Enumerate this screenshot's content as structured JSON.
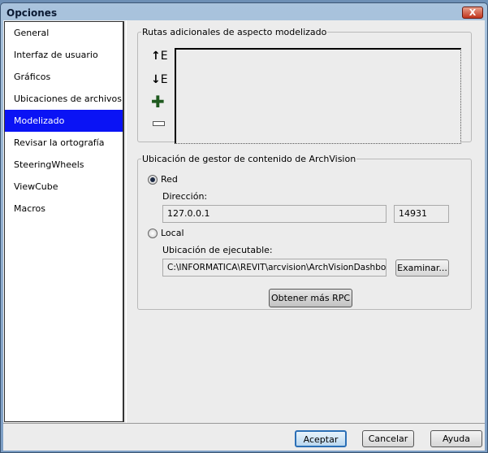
{
  "window": {
    "title": "Opciones",
    "close_label": "X"
  },
  "sidebar": {
    "items": [
      {
        "label": "General"
      },
      {
        "label": "Interfaz de usuario"
      },
      {
        "label": "Gráficos"
      },
      {
        "label": "Ubicaciones de archivos"
      },
      {
        "label": "Modelizado",
        "selected": true
      },
      {
        "label": "Revisar la ortografía"
      },
      {
        "label": "SteeringWheels"
      },
      {
        "label": "ViewCube"
      },
      {
        "label": "Macros"
      }
    ]
  },
  "paths_group": {
    "legend": "Rutas adicionales de aspecto modelizado",
    "tools": [
      "move-up-icon",
      "move-down-icon",
      "add-icon",
      "remove-icon"
    ]
  },
  "archvision_group": {
    "legend": "Ubicación de gestor de contenido de ArchVision",
    "red_label": "Red",
    "selected": "Red",
    "address_label": "Dirección:",
    "address_value": "127.0.0.1",
    "port_value": "14931",
    "local_label": "Local",
    "exec_label": "Ubicación de ejecutable:",
    "exec_value": "C:\\INFORMATICA\\REVIT\\arcvision\\ArchVisionDashboard",
    "browse_label": "Examinar...",
    "more_rpc_label": "Obtener más RPC"
  },
  "footer": {
    "ok": "Aceptar",
    "cancel": "Cancelar",
    "help": "Ayuda"
  },
  "colors": {
    "selection": "#0a13f5",
    "add_icon": "#1f5a1f"
  }
}
